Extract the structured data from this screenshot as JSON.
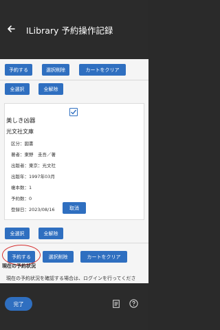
{
  "app": {
    "title": "ILibrary 予約操作記録"
  },
  "toolbar_top": {
    "reserve_label": "予約する",
    "clear_selection_label": "選択削除",
    "clear_cart_label": "カートをクリア",
    "select_all_label": "全選択",
    "deselect_all_label": "全解除"
  },
  "book": {
    "title": "美しき凶器",
    "publisher": "光文社文庫",
    "fields": [
      "区分：図書",
      "著者：東野　圭吾／著",
      "出版者：東京：光文社",
      "出版年：1997年03月",
      "複本数：1",
      "予約数：0",
      "登録日：2023/08/16"
    ],
    "cancel_label": "取消"
  },
  "toolbar_bottom": {
    "select_all_label": "全選択",
    "deselect_all_label": "全解除",
    "reserve_label": "予約する",
    "clear_selection_label": "選択削除",
    "clear_cart_label": "カートをクリア"
  },
  "status": {
    "section_title": "現在の予約状況",
    "message": "現在の予約状況を確認する場合は、ログインを行ってくださ"
  },
  "bottom_bar": {
    "done_label": "完了"
  },
  "colors": {
    "accent": "#2f6fc0",
    "annotation": "#d63030",
    "app_bar": "#2b2b2b"
  }
}
